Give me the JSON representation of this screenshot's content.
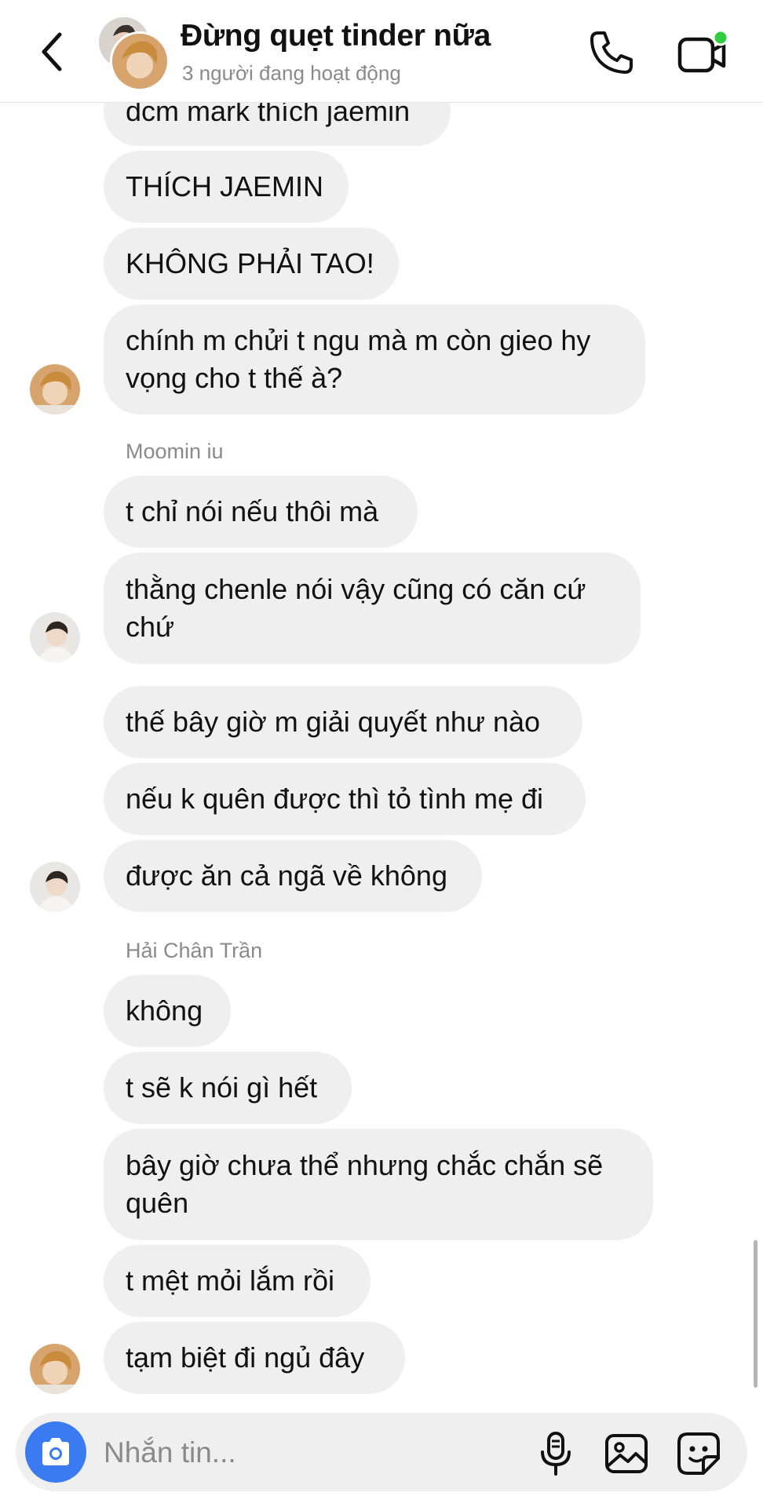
{
  "header": {
    "title": "Đừng quẹt tinder nữa",
    "subtitle": "3 người đang hoạt động"
  },
  "messages": [
    {
      "text": "dcm mark thích jaemin"
    },
    {
      "text": "THÍCH JAEMIN"
    },
    {
      "text": "KHÔNG PHẢI TAO!"
    },
    {
      "text": "chính m chửi t ngu mà m còn gieo hy\nvọng cho t thế à?"
    },
    {
      "sender": "Moomin iu"
    },
    {
      "text": "t chỉ nói nếu thôi mà"
    },
    {
      "text": "thằng chenle nói vậy cũng có căn cứ\nchứ"
    },
    {
      "text": "thế bây giờ m giải quyết như nào"
    },
    {
      "text": "nếu k quên được thì tỏ tình mẹ đi"
    },
    {
      "text": "được ăn cả ngã về không"
    },
    {
      "sender": "Hải Chân Trần"
    },
    {
      "text": "không"
    },
    {
      "text": "t sẽ k nói gì hết"
    },
    {
      "text": "bây giờ chưa thể nhưng chắc chắn sẽ\nquên"
    },
    {
      "text": "t mệt mỏi lắm rồi"
    },
    {
      "text": "tạm biệt đi ngủ đây"
    }
  ],
  "composer": {
    "placeholder": "Nhắn tin..."
  },
  "icons": {
    "back": "chevron-left-icon",
    "call": "phone-icon",
    "video": "video-camera-icon",
    "camera": "camera-icon",
    "mic": "microphone-icon",
    "gallery": "image-icon",
    "sticker": "sticker-icon"
  },
  "colors": {
    "bubble": "#efefef",
    "camera_button": "#3a7bf2",
    "active_dot": "#2ecc40"
  }
}
